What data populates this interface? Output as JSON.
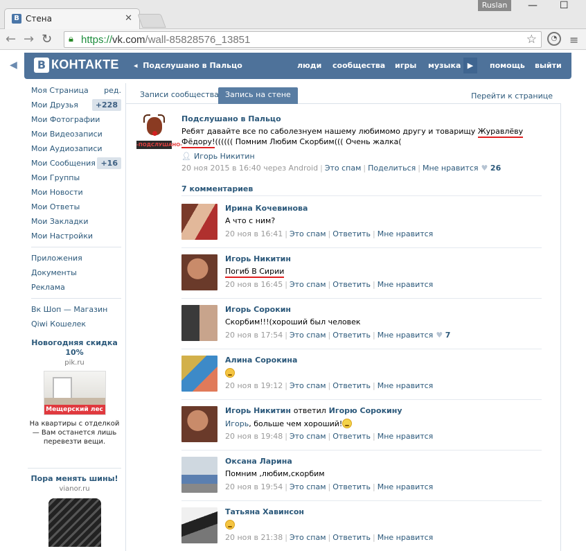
{
  "browser": {
    "tab_title": "Стена",
    "tab_favicon": "B",
    "user": "Ruslan",
    "url_https": "https://",
    "url_host": "vk.com",
    "url_path": "/wall-85828576_13851"
  },
  "vk": {
    "logo_letter": "B",
    "logo_text": "КОНТАКТЕ",
    "crumb": "Подслушано в Пальцо",
    "nav": [
      "люди",
      "сообщества",
      "игры",
      "музыка",
      "помощь",
      "выйти"
    ]
  },
  "sidebar": {
    "items": [
      {
        "label": "Моя Страница",
        "extra": "ред."
      },
      {
        "label": "Мои Друзья",
        "badge": "+228"
      },
      {
        "label": "Мои Фотографии"
      },
      {
        "label": "Мои Видеозаписи"
      },
      {
        "label": "Мои Аудиозаписи"
      },
      {
        "label": "Мои Сообщения",
        "badge": "+16"
      },
      {
        "label": "Мои Группы"
      },
      {
        "label": "Мои Новости"
      },
      {
        "label": "Мои Ответы"
      },
      {
        "label": "Мои Закладки"
      },
      {
        "label": "Мои Настройки"
      }
    ],
    "items2": [
      "Приложения",
      "Документы",
      "Реклама"
    ],
    "items3": [
      "Вк Шоп — Магазин",
      "Qiwi Кошелек"
    ]
  },
  "ads": [
    {
      "title": "Новогодняя скидка 10%",
      "domain": "pik.ru",
      "brand": "Мещерский лес",
      "text": "На квартиры с отделкой — Вам останется лишь перевезти вещи."
    },
    {
      "title": "Пора менять шины!",
      "domain": "vianor.ru"
    }
  ],
  "tabs": {
    "community": "Записи сообщества",
    "wall_post": "Запись на стене",
    "goto": "Перейти к странице"
  },
  "post": {
    "author": "Подслушано в Пальцо",
    "avatar_band": "-ПОДСЛУШАНО-",
    "text_before": "Ребят давайте все по саболезнуем нашему любимомо другу и товарищу ",
    "text_highlight": "Журавлёву Фёдору!",
    "text_after": "((((((  Помним Любим Скорбим((( Очень жалка(",
    "signer": "Игорь Никитин",
    "date": "20 ноя 2015 в 16:40 через Android",
    "spam": "Это спам",
    "share": "Поделиться",
    "like": "Мне нравится",
    "likes": "26"
  },
  "comments_header": "7 комментариев",
  "comment_labels": {
    "spam": "Это спам",
    "reply": "Ответить",
    "like": "Мне нравится"
  },
  "comments": [
    {
      "author": "Ирина Кочевинова",
      "text": "А что с ним?",
      "date": "20 ноя в 16:41"
    },
    {
      "author": "Игорь Никитин",
      "text": "Погиб В Сирии",
      "date": "20 ноя в 16:45"
    },
    {
      "author": "Игорь Сорокин",
      "text": "Скорбим!!!(хороший был человек",
      "date": "20 ноя в 17:54",
      "likes": "7"
    },
    {
      "author": "Алина Сорокина",
      "text": "",
      "date": "20 ноя в 19:12"
    },
    {
      "author": "Игорь Никитин",
      "replied": "ответил",
      "reply_to": "Игорю Сорокину",
      "reply_name": "Игорь",
      "text": ", больше чем хороший!",
      "date": "20 ноя в 19:48"
    },
    {
      "author": "Оксана Ларина",
      "text": "Помним ,любим,скорбим",
      "date": "20 ноя в 19:54"
    },
    {
      "author": "Татьяна Хавинсон",
      "text": "",
      "date": "20 ноя в 21:38"
    }
  ]
}
